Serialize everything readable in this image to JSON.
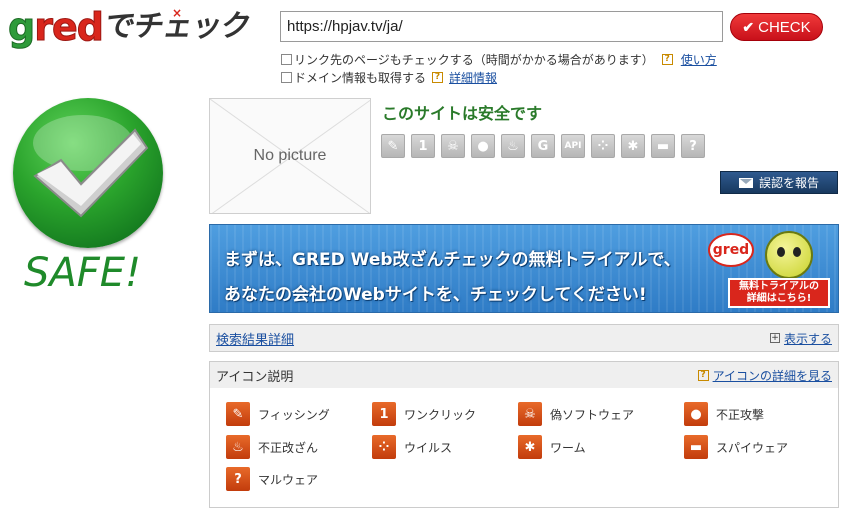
{
  "logo": {
    "part1": "g",
    "part2": "r",
    "part3": "ed",
    "part4": "でチェック"
  },
  "form": {
    "url_value": "https://hpjav.tv/ja/",
    "check_label": "CHECK",
    "option1": "リンク先のページもチェックする（時間がかかる場合があります）",
    "option1_link": "使い方",
    "option2": "ドメイン情報も取得する",
    "option2_link": "詳細情報"
  },
  "result": {
    "safe_label": "SAFE!",
    "nopicture": "No picture",
    "status": "このサイトは安全です",
    "report_label": "誤認を報告"
  },
  "threat_icons": [
    "phishing-icon",
    "one-click-icon",
    "fake-software-icon",
    "attack-icon",
    "defacement-icon",
    "g-icon",
    "api-icon",
    "virus-icon",
    "worm-icon",
    "spyware-icon",
    "malware-icon"
  ],
  "banner": {
    "line1": "まずは、GRED Web改ざんチェックの無料トライアルで、",
    "line2": "あなたの会社のWebサイトを、チェックしてください!",
    "bubble": "gred",
    "trial_line1": "無料トライアルの",
    "trial_line2": "詳細はこちら!"
  },
  "search_panel": {
    "title": "検索結果詳細",
    "action": "表示する"
  },
  "icons_panel": {
    "title": "アイコン説明",
    "action": "アイコンの詳細を見る",
    "items": [
      {
        "label": "フィッシング",
        "icon": "phishing-icon"
      },
      {
        "label": "ワンクリック",
        "icon": "one-click-icon"
      },
      {
        "label": "偽ソフトウェア",
        "icon": "fake-software-icon"
      },
      {
        "label": "不正攻撃",
        "icon": "attack-icon"
      },
      {
        "label": "不正改ざん",
        "icon": "defacement-icon"
      },
      {
        "label": "ウイルス",
        "icon": "virus-icon"
      },
      {
        "label": "ワーム",
        "icon": "worm-icon"
      },
      {
        "label": "スパイウェア",
        "icon": "spyware-icon"
      },
      {
        "label": "マルウェア",
        "icon": "malware-icon"
      }
    ]
  },
  "colors": {
    "safe_green": "#1f8a2a",
    "check_red": "#d9261c",
    "icon_orange": "#d8501a",
    "link_blue": "#1a4fa0"
  }
}
